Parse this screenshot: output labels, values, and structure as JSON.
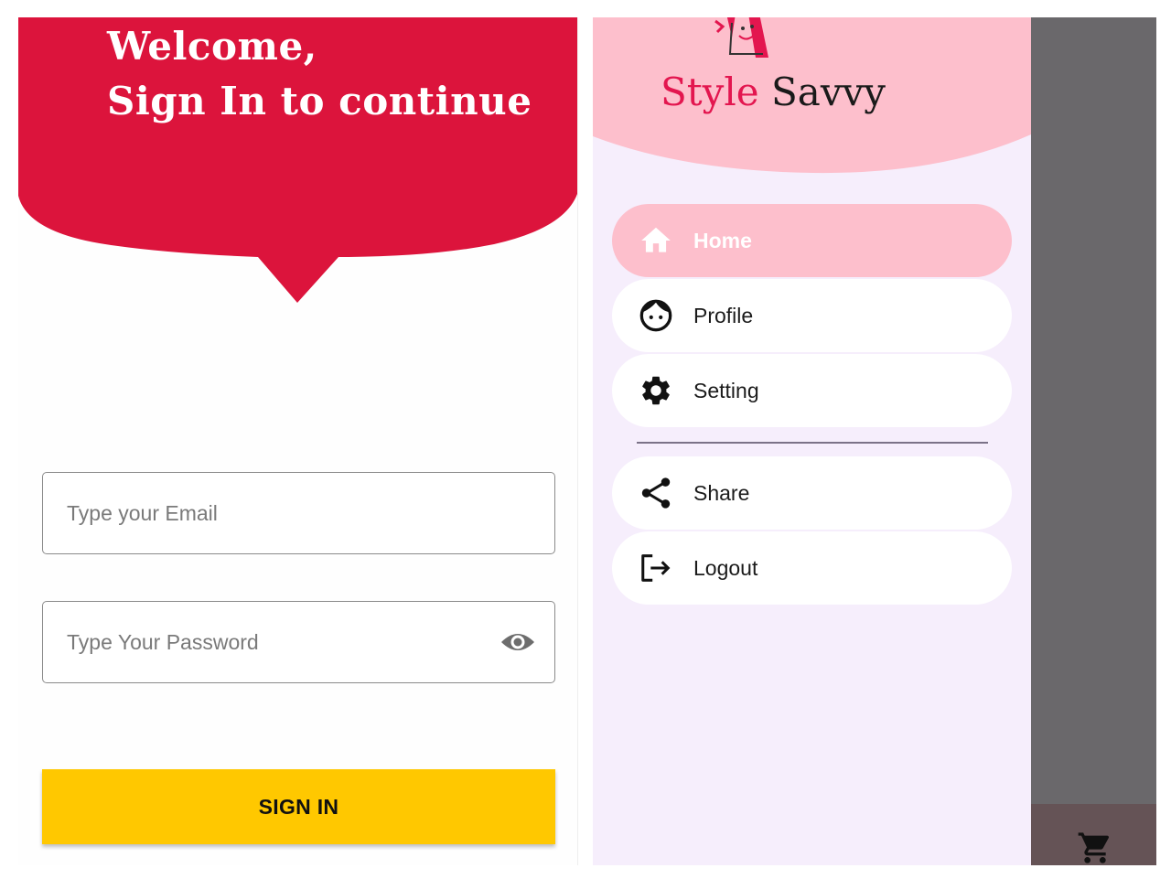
{
  "login": {
    "welcome_line1": "Welcome,",
    "welcome_line2": "Sign In to continue",
    "email_placeholder": "Type your Email",
    "password_placeholder": "Type Your Password",
    "signin_label": "SIGN IN"
  },
  "drawer": {
    "brand_part1": "Style",
    "brand_part2": "Savvy",
    "items": [
      {
        "label": "Home",
        "icon": "home-icon",
        "active": true
      },
      {
        "label": "Profile",
        "icon": "face-icon",
        "active": false
      },
      {
        "label": "Setting",
        "icon": "gear-icon",
        "active": false
      },
      {
        "label": "Share",
        "icon": "share-icon",
        "active": false
      },
      {
        "label": "Logout",
        "icon": "logout-icon",
        "active": false
      }
    ]
  },
  "bottom_bar": {
    "icon": "cart-icon"
  },
  "colors": {
    "header_red": "#dc143c",
    "signin_yellow": "#ffc800",
    "drawer_pink": "#fdbfcc",
    "drawer_bg": "#f6eefc",
    "scrim": "#6a686b",
    "brand_red": "#e3164f"
  }
}
